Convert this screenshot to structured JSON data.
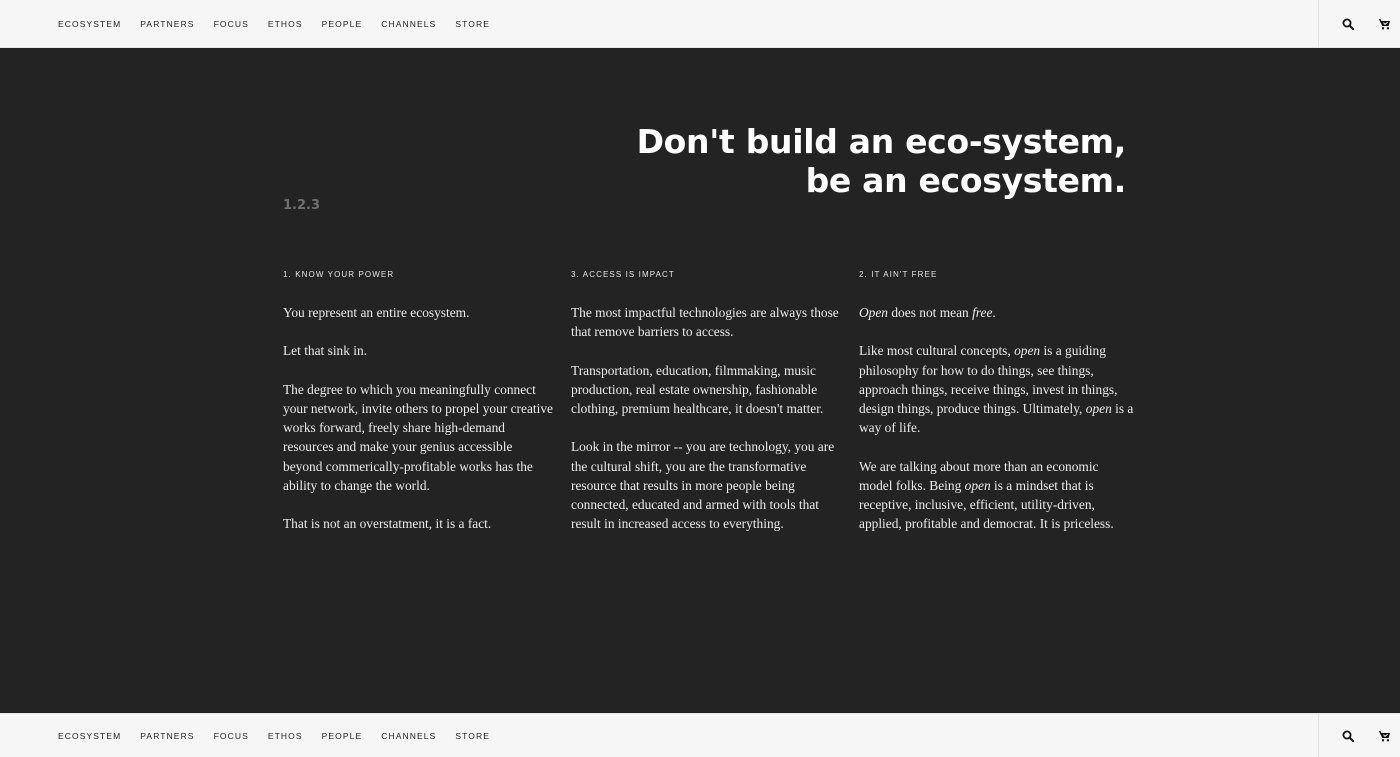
{
  "nav": {
    "items": [
      "ECOSYSTEM",
      "PARTNERS",
      "FOCUS",
      "ETHOS",
      "PEOPLE",
      "CHANNELS",
      "STORE"
    ],
    "icons": [
      "search-icon",
      "cart-icon"
    ]
  },
  "hero": {
    "line1": "Don't build an eco-system,",
    "line2": "be an ecosystem.",
    "version": "1.2.3"
  },
  "columns": [
    {
      "heading": "1. KNOW YOUR POWER",
      "p1": "You represent an entire ecosystem.",
      "p2": "Let that sink in.",
      "p3": "The degree to which you meaningfully connect your network, invite others to propel your creative works forward, freely share high-demand resources and make your genius accessible beyond commerically-profitable works has the ability to change the world.",
      "p4": "That is not an overstatment, it is a fact."
    },
    {
      "heading": "3. ACCESS IS IMPACT",
      "p1": "The most impactful technologies are always those that remove barriers to access.",
      "p2": "Transportation, education, filmmaking, music production, real estate ownership, fashionable clothing, premium healthcare, it doesn't matter.",
      "p3": "Look in the mirror -- you are technology, you are the cultural shift, you are the transformative resource that results in more people being connected, educated and armed with tools that result in increased access to everything."
    },
    {
      "heading": "2. IT AIN'T FREE",
      "p1_a": "Open",
      "p1_b": " does not mean ",
      "p1_c": "free",
      "p1_d": ".",
      "p2_a": "Like most cultural concepts, ",
      "p2_b": "open",
      "p2_c": " is a guiding philosophy for how to do things, see things, approach things, receive things, invest in things, design things, produce things. Ultimately, ",
      "p2_d": "open",
      "p2_e": " is a way of life.",
      "p3_a": "We are talking about more than an economic model folks. Being ",
      "p3_b": "open",
      "p3_c": " is a mindset that is receptive, inclusive, efficient, utility-driven, applied, profitable and democrat. It is priceless."
    }
  ]
}
